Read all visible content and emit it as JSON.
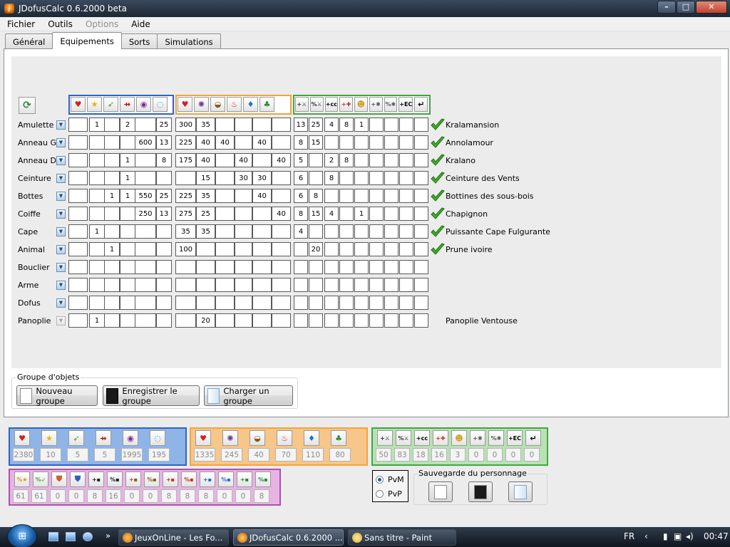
{
  "window": {
    "title": "JDofusCalc 0.6.2000 beta"
  },
  "menu": [
    "Fichier",
    "Outils",
    "Options",
    "Aide"
  ],
  "menu_disabled": [
    "Options"
  ],
  "tabs": [
    "Général",
    "Equipements",
    "Sorts",
    "Simulations"
  ],
  "active_tab": "Equipements",
  "header_icons": {
    "blue": [
      "heart-icon",
      "star-icon",
      "leaf-icon",
      "arrow-icon",
      "swirl-icon",
      "orb-icon"
    ],
    "orange": [
      "heart-icon",
      "spiral-icon",
      "bowl-icon",
      "fire-icon",
      "water-icon",
      "tree-icon"
    ],
    "green": [
      "plus-sword-icon",
      "percent-sword-icon",
      "plus-cc-icon",
      "plus-heal-icon",
      "summon-icon",
      "plus-trap-icon",
      "percent-trap-icon",
      "plus-ec-icon",
      "return-icon"
    ]
  },
  "equipment_rows": [
    {
      "label": "Amulette",
      "dropdown_enabled": true,
      "blue": [
        "",
        "1",
        "",
        "2",
        "",
        "25"
      ],
      "orange": [
        "300",
        "35",
        "",
        "",
        "",
        ""
      ],
      "green": [
        "13",
        "25",
        "4",
        "8",
        "1",
        "",
        "",
        "",
        ""
      ],
      "checked": true,
      "item": "Kralamansion"
    },
    {
      "label": "Anneau G.",
      "dropdown_enabled": true,
      "blue": [
        "",
        "",
        "",
        "",
        "600",
        "13"
      ],
      "orange": [
        "225",
        "40",
        "40",
        "",
        "40",
        ""
      ],
      "green": [
        "8",
        "15",
        "",
        "",
        "",
        "",
        "",
        "",
        ""
      ],
      "checked": true,
      "item": "Annolamour"
    },
    {
      "label": "Anneau D.",
      "dropdown_enabled": true,
      "blue": [
        "",
        "",
        "",
        "1",
        "",
        "8"
      ],
      "orange": [
        "175",
        "40",
        "",
        "40",
        "",
        "40"
      ],
      "green": [
        "5",
        "",
        "2",
        "8",
        "",
        "",
        "",
        "",
        ""
      ],
      "checked": true,
      "item": "Kralano"
    },
    {
      "label": "Ceinture",
      "dropdown_enabled": true,
      "blue": [
        "",
        "",
        "",
        "1",
        "",
        ""
      ],
      "orange": [
        "",
        "15",
        "",
        "30",
        "30",
        ""
      ],
      "green": [
        "6",
        "",
        "8",
        "",
        "",
        "",
        "",
        "",
        ""
      ],
      "checked": true,
      "item": "Ceinture des Vents"
    },
    {
      "label": "Bottes",
      "dropdown_enabled": true,
      "blue": [
        "",
        "",
        "1",
        "1",
        "550",
        "25"
      ],
      "orange": [
        "225",
        "35",
        "",
        "",
        "40",
        ""
      ],
      "green": [
        "6",
        "8",
        "",
        "",
        "",
        "",
        "",
        "",
        ""
      ],
      "checked": true,
      "item": "Bottines des sous-bois"
    },
    {
      "label": "Coiffe",
      "dropdown_enabled": true,
      "blue": [
        "",
        "",
        "",
        "",
        "250",
        "13"
      ],
      "orange": [
        "275",
        "25",
        "",
        "",
        "",
        "40"
      ],
      "green": [
        "8",
        "15",
        "4",
        "",
        "1",
        "",
        "",
        "",
        ""
      ],
      "checked": true,
      "item": "Chapignon"
    },
    {
      "label": "Cape",
      "dropdown_enabled": true,
      "blue": [
        "",
        "1",
        "",
        "",
        "",
        ""
      ],
      "orange": [
        "35",
        "35",
        "",
        "",
        "",
        ""
      ],
      "green": [
        "4",
        "",
        "",
        "",
        "",
        "",
        "",
        "",
        ""
      ],
      "checked": true,
      "item": "Puissante Cape Fulgurante"
    },
    {
      "label": "Animal",
      "dropdown_enabled": true,
      "blue": [
        "",
        "",
        "1",
        "",
        "",
        ""
      ],
      "orange": [
        "100",
        "",
        "",
        "",
        "",
        ""
      ],
      "green": [
        "",
        "20",
        "",
        "",
        "",
        "",
        "",
        "",
        ""
      ],
      "checked": true,
      "item": "Prune ivoire"
    },
    {
      "label": "Bouclier",
      "dropdown_enabled": true,
      "blue": [
        "",
        "",
        "",
        "",
        "",
        ""
      ],
      "orange": [
        "",
        "",
        "",
        "",
        "",
        ""
      ],
      "green": [
        "",
        "",
        "",
        "",
        "",
        "",
        "",
        "",
        ""
      ],
      "checked": false,
      "item": ""
    },
    {
      "label": "Arme",
      "dropdown_enabled": true,
      "blue": [
        "",
        "",
        "",
        "",
        "",
        ""
      ],
      "orange": [
        "",
        "",
        "",
        "",
        "",
        ""
      ],
      "green": [
        "",
        "",
        "",
        "",
        "",
        "",
        "",
        "",
        ""
      ],
      "checked": false,
      "item": ""
    },
    {
      "label": "Dofus",
      "dropdown_enabled": true,
      "blue": [
        "",
        "",
        "",
        "",
        "",
        ""
      ],
      "orange": [
        "",
        "",
        "",
        "",
        "",
        ""
      ],
      "green": [
        "",
        "",
        "",
        "",
        "",
        "",
        "",
        "",
        ""
      ],
      "checked": false,
      "item": ""
    },
    {
      "label": "Panoplie",
      "dropdown_enabled": false,
      "blue": [
        "",
        "1",
        "",
        "",
        "",
        ""
      ],
      "orange": [
        "",
        "20",
        "",
        "",
        "",
        ""
      ],
      "green": [
        "",
        "",
        "",
        "",
        "",
        "",
        "",
        "",
        ""
      ],
      "checked": false,
      "item": "Panoplie  Ventouse"
    }
  ],
  "group": {
    "label": "Groupe d'objets",
    "buttons": [
      "Nouveau groupe",
      "Enregistrer le groupe",
      "Charger un groupe"
    ]
  },
  "summary": {
    "blue": [
      "2380",
      "10",
      "5",
      "5",
      "1995",
      "195"
    ],
    "orange": [
      "1335",
      "245",
      "40",
      "70",
      "110",
      "80"
    ],
    "green": [
      "50",
      "83",
      "18",
      "16",
      "3",
      "0",
      "0",
      "0",
      "0"
    ],
    "purple_icons": [
      "percent-star-icon",
      "percent-leaf-icon",
      "shield-orange-icon",
      "shield-blue-icon",
      "plus-neutral-icon",
      "percent-neutral-icon",
      "plus-earth-icon",
      "percent-earth-icon",
      "plus-fire-icon",
      "percent-fire-icon",
      "plus-water-icon",
      "percent-water-icon",
      "plus-air-icon",
      "percent-air-icon"
    ],
    "purple": [
      "61",
      "61",
      "0",
      "0",
      "8",
      "16",
      "0",
      "0",
      "8",
      "8",
      "8",
      "0",
      "0",
      "8"
    ]
  },
  "mode": {
    "options": [
      "PvM",
      "PvP"
    ],
    "selected": "PvM"
  },
  "save_panel": {
    "label": "Sauvegarde du personnage"
  },
  "taskbar": {
    "items": [
      "JeuxOnLine - Les Fo...",
      "JDofusCalc 0.6.2000 ...",
      "Sans titre - Paint"
    ],
    "active": "JDofusCalc 0.6.2000 ...",
    "lang": "FR",
    "time": "00:47"
  },
  "colors": {
    "blue_group": "#2f64c0",
    "orange_group": "#f5a33b",
    "green_group": "#3fa83c",
    "purple_group": "#b24fb0",
    "blue_bg": "#8fb4e8",
    "orange_bg": "#f6c68a",
    "green_bg": "#b9e2b4",
    "purple_bg": "#e6b4e3"
  }
}
